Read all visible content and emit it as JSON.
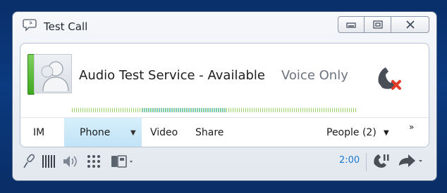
{
  "window": {
    "title": "Test Call",
    "controls": {
      "minimize": "minimize",
      "maximize": "maximize",
      "close": "close"
    }
  },
  "contact": {
    "name": "Audio Test Service - Available",
    "mode": "Voice Only",
    "presence_color": "#4cb72a"
  },
  "tabs": [
    {
      "label": "IM"
    },
    {
      "label": "Phone",
      "selected": true
    },
    {
      "label": "Video"
    },
    {
      "label": "Share"
    },
    {
      "label": "People (2)"
    }
  ],
  "tab_more": "»",
  "toolbar": {
    "icons": [
      "mic-icon",
      "dtmf-bars-icon",
      "speaker-icon",
      "dialpad-icon",
      "device-icon",
      "hold-icon",
      "transfer-icon"
    ],
    "timer": "2:00"
  },
  "colors": {
    "background": "#0b3a80",
    "accent": "#1b7ad0",
    "hangup": "#e23d28"
  }
}
